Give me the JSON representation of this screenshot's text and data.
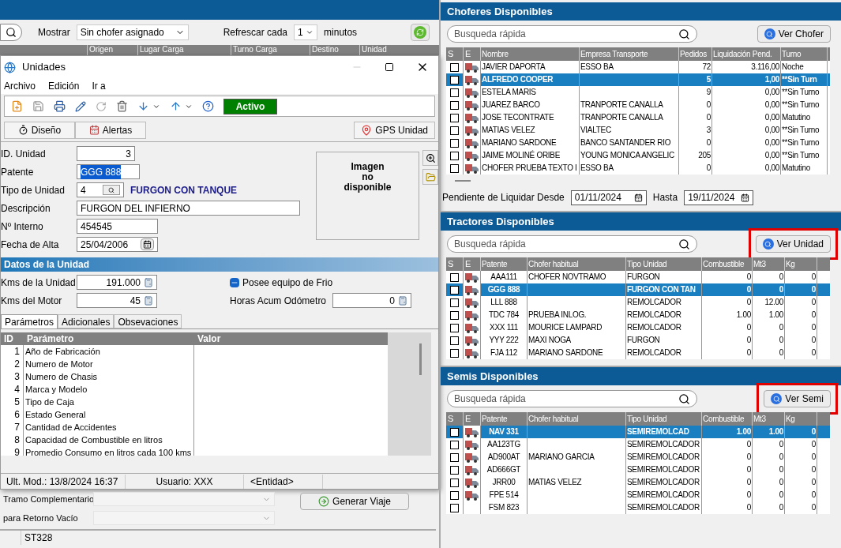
{
  "app": {
    "filter": {
      "label": "Mostrar",
      "value": "Sin chofer asignado"
    },
    "refresh": {
      "label": "Refrescar cada",
      "value": "1",
      "unit": "minutos"
    },
    "grid_columns": [
      "Origen",
      "Lugar Carga",
      "Turno Carga",
      "Destino",
      "Unidad"
    ],
    "trip_fields": [
      "Tramo Complementario",
      "para Retorno Vacío"
    ],
    "generate_button": "Generar Viaje",
    "status_bar": [
      "ST328"
    ]
  },
  "window": {
    "title": "Unidades",
    "menu": [
      "Archivo",
      "Edición",
      "Ir a"
    ],
    "status_badge": "Activo",
    "view_buttons": [
      "Diseño",
      "Alertas"
    ],
    "gps_button": "GPS Unidad",
    "fields": [
      {
        "label": "ID. Unidad",
        "value": "3",
        "kind": "number",
        "highlighted": false
      },
      {
        "label": "Patente",
        "value": "GGG 888",
        "kind": "short",
        "highlighted": true
      },
      {
        "label": "Tipo de Unidad",
        "value": "4",
        "kind": "lookup",
        "description": "FURGON CON TANQUE",
        "highlighted": false
      },
      {
        "label": "Descripción",
        "value": "FURGON DEL INFIERNO",
        "kind": "long",
        "highlighted": false
      },
      {
        "label": "Nº Interno",
        "value": "454545",
        "kind": "medium",
        "highlighted": false
      },
      {
        "label": "Fecha de Alta",
        "value": "25/04/2006",
        "kind": "date",
        "highlighted": false
      }
    ],
    "image_placeholder": [
      "Imagen",
      "no",
      "disponible"
    ],
    "section_title": "Datos de la Unidad",
    "unit_fields": [
      {
        "label": "Kms de la Unidad",
        "value": "191.000"
      },
      {
        "label": "Kms del Motor",
        "value": "45"
      }
    ],
    "cold_equipment": {
      "label": "Posee equipo de Frio",
      "checked": true
    },
    "odometer": {
      "label": "Horas Acum Odómetro",
      "value": "0"
    },
    "tabs": [
      {
        "label": "Parámetros",
        "selected": true
      },
      {
        "label": "Adicionales",
        "selected": false
      },
      {
        "label": "Obsevaciones",
        "selected": false
      }
    ],
    "params": {
      "columns": [
        "ID",
        "Parámetro",
        "Valor"
      ],
      "rows": [
        [
          "1",
          "Año de Fabricación"
        ],
        [
          "2",
          "Numero de Motor"
        ],
        [
          "3",
          "Numero de Chasis"
        ],
        [
          "4",
          "Marca y Modelo"
        ],
        [
          "5",
          "Tipo de Caja"
        ],
        [
          "6",
          "Estado General"
        ],
        [
          "7",
          "Cantidad de Accidentes"
        ],
        [
          "8",
          "Capacidad de Combustible en litros"
        ],
        [
          "9",
          "Promedio Consumo en litros cada 100 kms"
        ]
      ]
    },
    "status": [
      "Ult. Mod.: 13/8/2024 16:37",
      "Usuario: XXX",
      "<Entidad>"
    ]
  },
  "drivers": {
    "title": "Choferes Disponibles",
    "search_placeholder": "Busqueda rápida",
    "button": "Ver Chofer",
    "highlighted": false,
    "select_header": "S",
    "status_header": "E",
    "columns": [
      "Nombre",
      "Empresa Transporte",
      "Pedidos",
      "Liquidación Pend.",
      "Turno"
    ],
    "rows": [
      {
        "selected": false,
        "checked": false,
        "status_icon": true,
        "cells": [
          "JAVIER DAPORTA",
          "ESSO BA",
          "72",
          "3.116,00",
          "Noche"
        ]
      },
      {
        "selected": true,
        "checked": false,
        "status_icon": true,
        "cells": [
          "ALFREDO COOPER",
          "",
          "5",
          "1,00",
          "**Sin Turn"
        ]
      },
      {
        "selected": false,
        "checked": false,
        "status_icon": true,
        "cells": [
          "ESTELA MARIS",
          "",
          "9",
          "0,00",
          "**Sin Turno"
        ]
      },
      {
        "selected": false,
        "checked": false,
        "status_icon": true,
        "cells": [
          "JUAREZ BARCO",
          "TRANPORTE CANALLA",
          "0",
          "0,00",
          "**Sin Turno"
        ]
      },
      {
        "selected": false,
        "checked": false,
        "status_icon": true,
        "cells": [
          "JOSE TECONTRATE",
          "TRANPORTE CANALLA",
          "0",
          "0,00",
          "Matutino"
        ]
      },
      {
        "selected": false,
        "checked": false,
        "status_icon": true,
        "cells": [
          "MATIAS VELEZ",
          "VIALTEC",
          "3",
          "0,00",
          "**Sin Turno"
        ]
      },
      {
        "selected": false,
        "checked": false,
        "status_icon": true,
        "cells": [
          "MARIANO SARDONE",
          "BANCO SANTANDER RIO",
          "0",
          "0,00",
          "**Sin Turno"
        ]
      },
      {
        "selected": false,
        "checked": false,
        "status_icon": true,
        "cells": [
          "JAIME MOLINÉ ORIBE",
          "YOUNG MONICA ANGELIC",
          "205",
          "0,00",
          "**Sin Turno"
        ]
      },
      {
        "selected": false,
        "checked": false,
        "status_icon": true,
        "cells": [
          "CHOFER PRUEBA TEXTO I",
          "ESSO BA",
          "0",
          "0,00",
          "Matutino"
        ]
      }
    ],
    "pending": {
      "label": "Pendiente de Liquidar Desde",
      "from": "01/11/2024",
      "to_label": "Hasta",
      "to": "19/11/2024"
    }
  },
  "tractors": {
    "title": "Tractores Disponibles",
    "search_placeholder": "Busqueda rápida",
    "button": "Ver Unidad",
    "highlighted": true,
    "select_header": "S",
    "status_header": "E",
    "columns": [
      "Patente",
      "Chofer habitual",
      "Tipo Unidad",
      "Combustible",
      "Mt3",
      "Kg"
    ],
    "rows": [
      {
        "selected": false,
        "checked": false,
        "status_icon": true,
        "cells": [
          "AAA111",
          "CHOFER NOVTRAMO",
          "FURGON",
          "0",
          "0",
          "0"
        ]
      },
      {
        "selected": true,
        "checked": false,
        "status_icon": true,
        "cells": [
          "GGG 888",
          "",
          "FURGON CON TAN",
          "0",
          "0",
          "0"
        ]
      },
      {
        "selected": false,
        "checked": false,
        "status_icon": true,
        "cells": [
          "LLL 888",
          "",
          "REMOLCADOR",
          "0",
          "12.00",
          "0"
        ]
      },
      {
        "selected": false,
        "checked": false,
        "status_icon": true,
        "cells": [
          "TDC 784",
          "PRUEBA INLOG.",
          "REMOLCADOR",
          "1.00",
          "1.00",
          "0"
        ]
      },
      {
        "selected": false,
        "checked": false,
        "status_icon": true,
        "cells": [
          "XXX 111",
          "MOURICE LAMPARD",
          "REMOLCADOR",
          "0",
          "0",
          "0"
        ]
      },
      {
        "selected": false,
        "checked": false,
        "status_icon": true,
        "cells": [
          "YYY 222",
          "MAXI NOGA",
          "FURGON",
          "0",
          "0",
          "0"
        ]
      },
      {
        "selected": false,
        "checked": false,
        "status_icon": true,
        "cells": [
          "FJA 112",
          "MARIANO SARDONE",
          "REMOLCADOR",
          "0",
          "0",
          "0"
        ]
      }
    ]
  },
  "semis": {
    "title": "Semis Disponibles",
    "search_placeholder": "Busqueda rápida",
    "button": "Ver Semi",
    "highlighted": true,
    "select_header": "S",
    "status_header": "E",
    "columns": [
      "Patente",
      "Chofer habitual",
      "Tipo Unidad",
      "Combustible",
      "Mt3",
      "Kg"
    ],
    "rows": [
      {
        "selected": true,
        "checked": false,
        "status_icon": true,
        "cells": [
          "NAV 331",
          "",
          "SEMIREMOLCAD",
          "1.00",
          "1.00",
          "0"
        ]
      },
      {
        "selected": false,
        "checked": false,
        "status_icon": true,
        "cells": [
          "AA123TG",
          "",
          "SEMIREMOLCADOR",
          "0",
          "0",
          "0"
        ]
      },
      {
        "selected": false,
        "checked": false,
        "status_icon": true,
        "cells": [
          "AD900AT",
          "MARIANO GARCIA",
          "SEMIREMOLCADOR",
          "0",
          "0",
          "0"
        ]
      },
      {
        "selected": false,
        "checked": false,
        "status_icon": true,
        "cells": [
          "AD666GT",
          "",
          "SEMIREMOLCADOR",
          "0",
          "0",
          "0"
        ]
      },
      {
        "selected": false,
        "checked": false,
        "status_icon": true,
        "cells": [
          "JRR00",
          "MATIAS VELEZ",
          "SEMIREMOLCADOR",
          "0",
          "0",
          "0"
        ]
      },
      {
        "selected": false,
        "checked": false,
        "status_icon": true,
        "cells": [
          "FPE 514",
          "",
          "SEMIREMOLCADOR",
          "0",
          "0",
          "0"
        ]
      },
      {
        "selected": false,
        "checked": false,
        "status_icon": false,
        "cells": [
          "FSM 823",
          "",
          "SEMIREMOLCADOR",
          "0",
          "0",
          "0"
        ]
      }
    ]
  }
}
